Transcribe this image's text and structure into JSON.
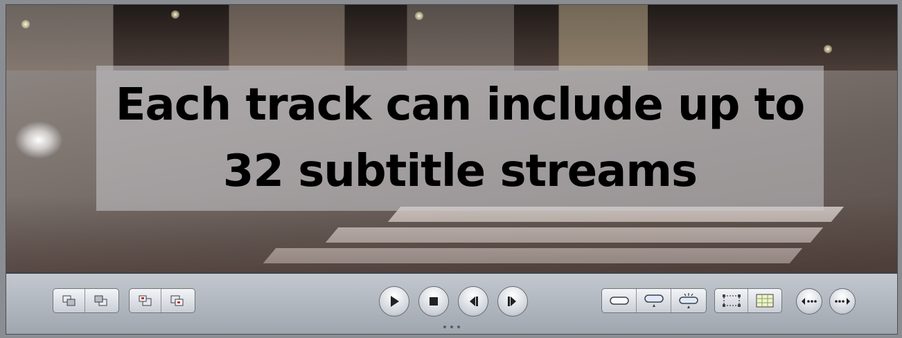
{
  "viewer": {
    "caption_line1": "Each track can include up to",
    "caption_line2": "32 subtitle streams"
  },
  "controller": {
    "left_group_1": [
      "window-front-icon",
      "window-back-icon"
    ],
    "left_group_2": [
      "mark-in-icon",
      "mark-out-icon"
    ],
    "transport": [
      "play-icon",
      "stop-icon",
      "previous-frame-icon",
      "next-frame-icon"
    ],
    "subtitle_group": [
      "subtitle-off-icon",
      "subtitle-bottom-icon",
      "subtitle-animated-icon"
    ],
    "view_group": [
      "safe-area-icon",
      "grid-icon"
    ],
    "nav": [
      "previous-chapter-icon",
      "next-chapter-icon"
    ]
  },
  "colors": {
    "caption_text": "#000000",
    "controller_top": "#c3c8cf",
    "controller_bottom": "#9fa5ae"
  }
}
